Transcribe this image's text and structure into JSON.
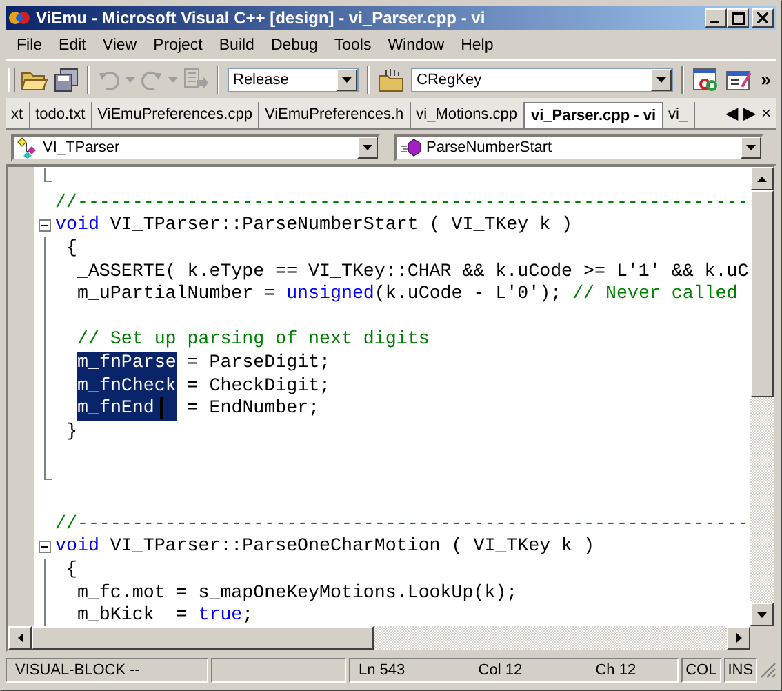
{
  "window": {
    "title": "ViEmu - Microsoft Visual C++ [design] - vi_Parser.cpp - vi"
  },
  "menu": [
    "File",
    "Edit",
    "View",
    "Project",
    "Build",
    "Debug",
    "Tools",
    "Window",
    "Help"
  ],
  "toolbar": {
    "undo_disabled": true,
    "redo_disabled": true,
    "configuration": "Release",
    "class_field": "CRegKey",
    "overflow": "»"
  },
  "tabs": [
    {
      "label": "xt",
      "selected": false
    },
    {
      "label": "todo.txt",
      "selected": false
    },
    {
      "label": "ViEmuPreferences.cpp",
      "selected": false
    },
    {
      "label": "ViEmuPreferences.h",
      "selected": false
    },
    {
      "label": "vi_Motions.cpp",
      "selected": false
    },
    {
      "label": "vi_Parser.cpp - vi",
      "selected": true
    },
    {
      "label": "vi_",
      "selected": false
    }
  ],
  "tab_controls": [
    "◀",
    "▶",
    "×"
  ],
  "navigation": {
    "type_combo": "VI_TParser",
    "member_combo": "ParseNumberStart"
  },
  "code_lines": [
    {
      "fold_end": true
    },
    {
      "segments": [
        {
          "kind": "comment",
          "text": "//-------------------------------------------------------------"
        }
      ]
    },
    {
      "fold_start": true,
      "segments": [
        {
          "kind": "keyword",
          "text": "void"
        },
        {
          "kind": "code",
          "text": " VI_TParser::ParseNumberStart ( VI_TKey k )"
        }
      ]
    },
    {
      "in_fold": true,
      "segments": [
        {
          "kind": "code",
          "text": " {"
        }
      ]
    },
    {
      "in_fold": true,
      "segments": [
        {
          "kind": "code",
          "text": "  _ASSERTE( k.eType == VI_TKey::CHAR && k.uCode >= L'1' && k.uC"
        }
      ]
    },
    {
      "in_fold": true,
      "segments": [
        {
          "kind": "code",
          "text": "  m_uPartialNumber = "
        },
        {
          "kind": "keyword",
          "text": "unsigned"
        },
        {
          "kind": "code",
          "text": "(k.uCode - L'0'); "
        },
        {
          "kind": "comment",
          "text": "// Never called"
        }
      ]
    },
    {
      "in_fold": true
    },
    {
      "in_fold": true,
      "segments": [
        {
          "kind": "comment",
          "text": "  // Set up parsing of next digits"
        }
      ]
    },
    {
      "in_fold": true,
      "segments": [
        {
          "kind": "selected",
          "text": "m_fnParse"
        },
        {
          "kind": "code",
          "text": " = ParseDigit;"
        }
      ]
    },
    {
      "in_fold": true,
      "segments": [
        {
          "kind": "selected",
          "text": "m_fnCheck"
        },
        {
          "kind": "code",
          "text": " = CheckDigit;"
        }
      ]
    },
    {
      "in_fold": true,
      "caret": true,
      "segments": [
        {
          "kind": "selected",
          "text": "m_fnEnd  "
        },
        {
          "kind": "code",
          "text": " = EndNumber;"
        }
      ]
    },
    {
      "in_fold": true,
      "segments": [
        {
          "kind": "code",
          "text": " }"
        }
      ]
    },
    {
      "in_fold": true
    },
    {
      "fold_end": true
    },
    {
      "gap_before": true,
      "segments": [
        {
          "kind": "comment",
          "text": "//-------------------------------------------------------------"
        }
      ]
    },
    {
      "fold_start": true,
      "segments": [
        {
          "kind": "keyword",
          "text": "void"
        },
        {
          "kind": "code",
          "text": " VI_TParser::ParseOneCharMotion ( VI_TKey k )"
        }
      ]
    },
    {
      "in_fold": true,
      "segments": [
        {
          "kind": "code",
          "text": " {"
        }
      ]
    },
    {
      "in_fold": true,
      "segments": [
        {
          "kind": "code",
          "text": "  m_fc.mot = s_mapOneKeyMotions.LookUp(k);"
        }
      ]
    },
    {
      "in_fold": true,
      "segments": [
        {
          "kind": "code",
          "text": "  m_bKick  = "
        },
        {
          "kind": "keyword",
          "text": "true"
        },
        {
          "kind": "code",
          "text": ";"
        }
      ]
    }
  ],
  "status_bar": {
    "mode": "VISUAL-BLOCK --",
    "line": "Ln 543",
    "column": "Col 12",
    "char": "Ch 12",
    "col_indicator": "COL",
    "ins_indicator": "INS"
  }
}
